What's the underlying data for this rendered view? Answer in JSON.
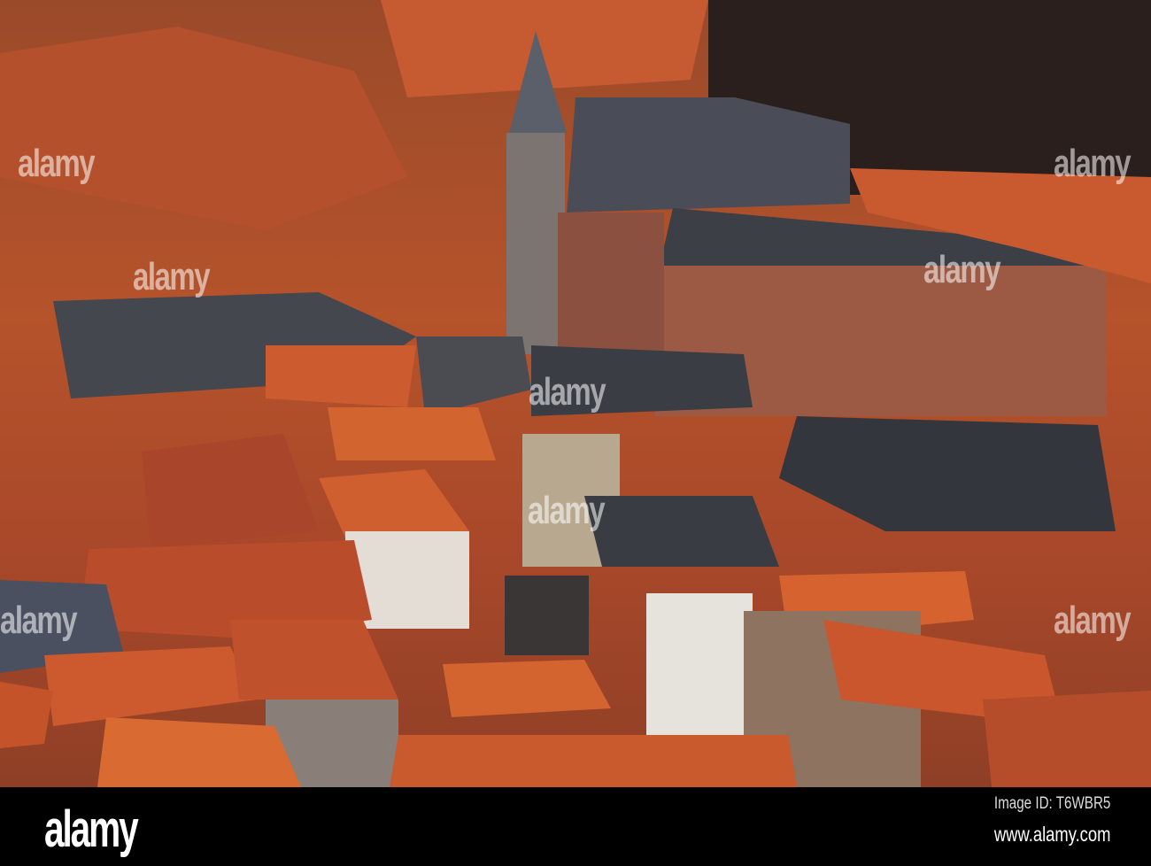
{
  "photo": {
    "subject": "rooftops",
    "watermark": "alamy",
    "colors": {
      "roof": "#c4532a",
      "brick": "#9c5a44",
      "slate": "#3d3f47",
      "trees": "#2a1f1c"
    }
  },
  "footer": {
    "logo": "alamy",
    "image_id": "Image ID: T6WBR5",
    "site": "www.alamy.com"
  }
}
